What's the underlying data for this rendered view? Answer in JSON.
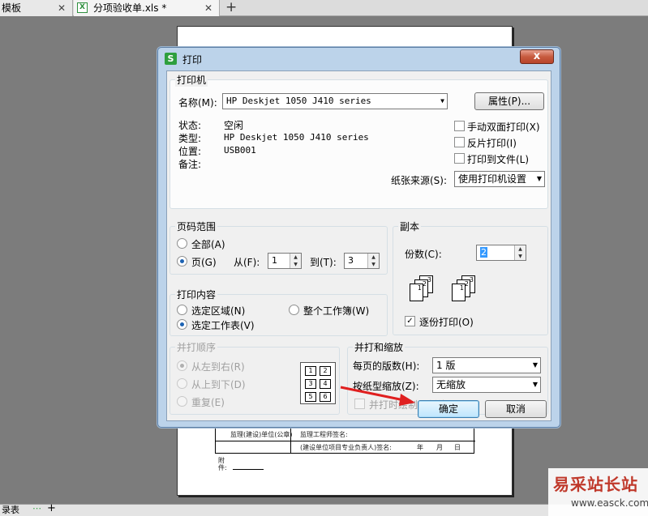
{
  "tabs": [
    {
      "label": "模板"
    },
    {
      "label": "分项验收单.xls *"
    }
  ],
  "new_tab": "+",
  "background_sheet": {
    "row1_left": "监理(建设)单位(公章)",
    "row1_mid": "监理工程师签名:",
    "row2_mid": "(建设单位项目专业负责人)签名:",
    "date_y": "年",
    "date_m": "月",
    "date_d": "日",
    "attach_label_1": "附",
    "attach_label_2": "件:",
    "sheet_tab": "录表"
  },
  "watermark": {
    "brand": "易采站长站",
    "url": "www.easck.com"
  },
  "dialog": {
    "title": "打印",
    "app_icon": "S",
    "close": "x",
    "printer": {
      "legend": "打印机",
      "name_label": "名称(M):",
      "name_value": "HP Deskjet 1050 J410 series",
      "props_button": "属性(P)...",
      "status_label": "状态:",
      "status_value": "空闲",
      "type_label": "类型:",
      "type_value": "HP Deskjet 1050 J410 series",
      "where_label": "位置:",
      "where_value": "USB001",
      "comment_label": "备注:",
      "manual_duplex": "手动双面打印(X)",
      "reverse_print": "反片打印(I)",
      "print_to_file": "打印到文件(L)",
      "paper_source_label": "纸张来源(S):",
      "paper_source_value": "使用打印机设置"
    },
    "page_range": {
      "legend": "页码范围",
      "all_label": "全部(A)",
      "pages_label": "页(G)",
      "from_label": "从(F):",
      "from_value": "1",
      "to_label": "到(T):",
      "to_value": "3"
    },
    "copies": {
      "legend": "副本",
      "count_label": "份数(C):",
      "count_value": "2",
      "collate_label": "逐份打印(O)",
      "collate_pages": [
        "1",
        "2",
        "3"
      ]
    },
    "print_what": {
      "legend": "打印内容",
      "selection_label": "选定区域(N)",
      "workbook_label": "整个工作簿(W)",
      "sheet_label": "选定工作表(V)"
    },
    "order": {
      "legend": "并打顺序",
      "ltr_label": "从左到右(R)",
      "ttb_label": "从上到下(D)",
      "repeat_label": "重复(E)",
      "grid": [
        "1",
        "2",
        "3",
        "4",
        "5",
        "6"
      ]
    },
    "zoom": {
      "legend": "并打和缩放",
      "pages_per_sheet_label": "每页的版数(H):",
      "pages_per_sheet_value": "1 版",
      "scale_label": "按纸型缩放(Z):",
      "scale_value": "无缩放",
      "draw_lines_label": "并打时绘制分割线(U)"
    },
    "ok_button": "确定",
    "cancel_button": "取消"
  }
}
